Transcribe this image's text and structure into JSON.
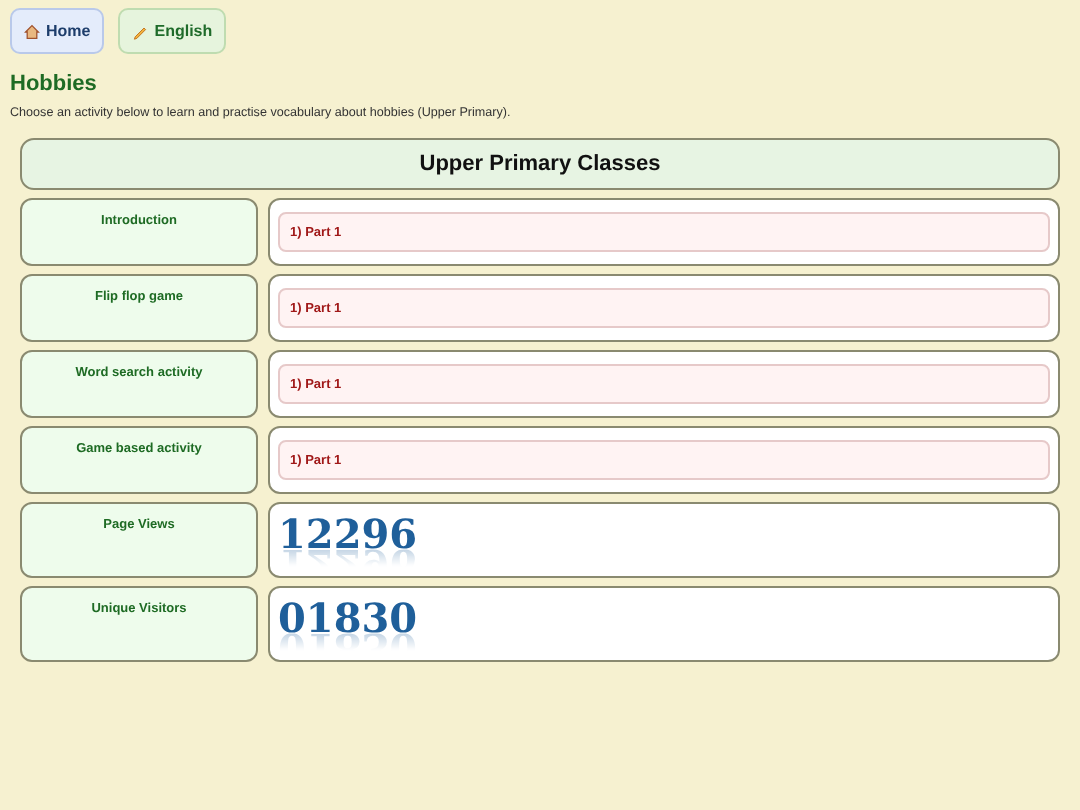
{
  "nav": [
    {
      "label": "Home",
      "kind": "home"
    },
    {
      "label": "English",
      "kind": "subject"
    }
  ],
  "title": "Hobbies",
  "description": "Choose an activity below to learn and practise vocabulary about hobbies (Upper Primary).",
  "table": {
    "heading": "Upper Primary Classes",
    "rows": [
      {
        "label": "Introduction",
        "kind": "links",
        "links": [
          "1) Part 1"
        ]
      },
      {
        "label": "Flip flop game",
        "kind": "links",
        "links": [
          "1) Part 1"
        ]
      },
      {
        "label": "Word search activity",
        "kind": "links",
        "links": [
          "1) Part 1"
        ]
      },
      {
        "label": "Game based activity",
        "kind": "links",
        "links": [
          "1) Part 1"
        ]
      },
      {
        "label": "Page Views",
        "kind": "counter",
        "value": "12296"
      },
      {
        "label": "Unique Visitors",
        "kind": "counter",
        "value": "01830"
      }
    ]
  }
}
